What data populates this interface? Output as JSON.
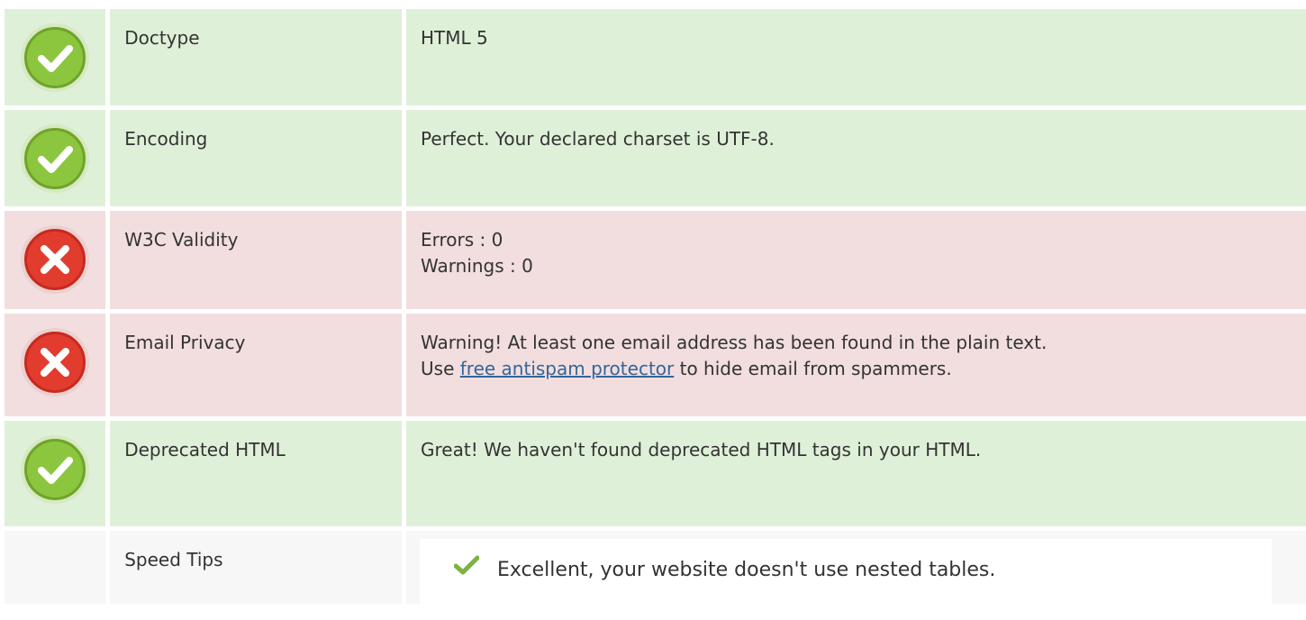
{
  "rows": [
    {
      "status": "ok",
      "icon": "check-circle-icon",
      "label": "Doctype",
      "value_lines": [
        "HTML 5"
      ]
    },
    {
      "status": "ok",
      "icon": "check-circle-icon",
      "label": "Encoding",
      "value_lines": [
        "Perfect. Your declared charset is UTF-8."
      ]
    },
    {
      "status": "error",
      "icon": "error-circle-icon",
      "label": "W3C Validity",
      "value_lines": [
        "Errors : 0",
        "Warnings : 0"
      ]
    },
    {
      "status": "error",
      "icon": "error-circle-icon",
      "label": "Email Privacy",
      "value_line1": "Warning! At least one email address has been found in the plain text.",
      "value_line2_prefix": "Use ",
      "value_line2_link": "free antispam protector",
      "value_line2_suffix": " to hide email from spammers."
    },
    {
      "status": "ok",
      "icon": "check-circle-icon",
      "label": "Deprecated HTML",
      "value_lines": [
        "Great! We haven't found deprecated HTML tags in your HTML."
      ]
    },
    {
      "status": "neutral",
      "label": "Speed Tips",
      "tips": [
        "Excellent, your website doesn't use nested tables."
      ]
    }
  ],
  "colors": {
    "ok_bg": "#dff0d8",
    "error_bg": "#f2dede",
    "neutral_bg": "#f7f7f7",
    "ok_icon": "#8cc63f",
    "error_icon": "#e23c2f",
    "link": "#34669a"
  }
}
